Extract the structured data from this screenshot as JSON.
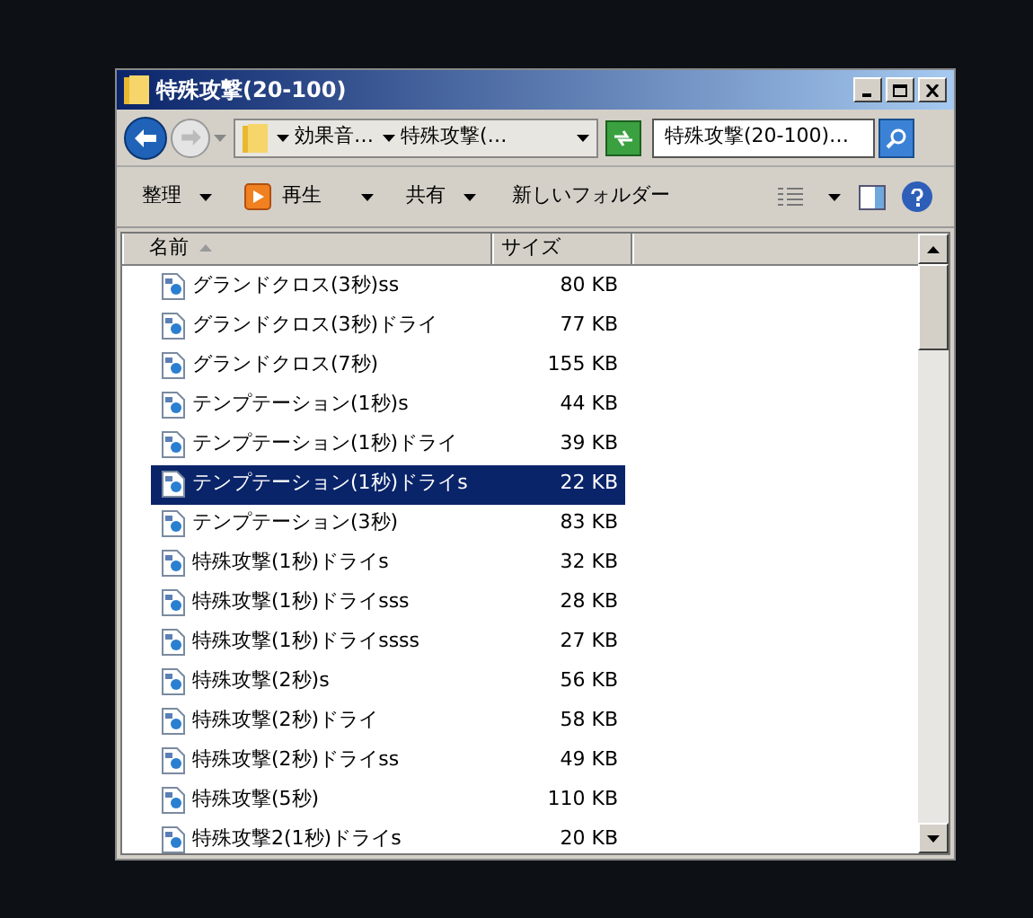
{
  "window": {
    "title": "特殊攻撃(20-100)"
  },
  "address": {
    "crumbs": [
      "効果音…",
      "特殊攻撃(…"
    ]
  },
  "search": {
    "value": "特殊攻撃(20-100)…"
  },
  "toolbar": [
    {
      "label": "整理",
      "kind": "menu"
    },
    {
      "label": "再生",
      "kind": "play"
    },
    {
      "label": "共有",
      "kind": "menu"
    },
    {
      "label": "新しいフォルダー",
      "kind": "plain"
    }
  ],
  "columns": [
    {
      "label": "名前",
      "sorted": true
    },
    {
      "label": "サイズ",
      "sorted": false
    }
  ],
  "rows": [
    {
      "name": "グランドクロス(3秒)ss",
      "size": "80 KB",
      "selected": false
    },
    {
      "name": "グランドクロス(3秒)ドライ",
      "size": "77 KB",
      "selected": false
    },
    {
      "name": "グランドクロス(7秒)",
      "size": "155 KB",
      "selected": false
    },
    {
      "name": "テンプテーション(1秒)s",
      "size": "44 KB",
      "selected": false
    },
    {
      "name": "テンプテーション(1秒)ドライ",
      "size": "39 KB",
      "selected": false
    },
    {
      "name": "テンプテーション(1秒)ドライs",
      "size": "22 KB",
      "selected": true
    },
    {
      "name": "テンプテーション(3秒)",
      "size": "83 KB",
      "selected": false
    },
    {
      "name": "特殊攻撃(1秒)ドライs",
      "size": "32 KB",
      "selected": false
    },
    {
      "name": "特殊攻撃(1秒)ドライsss",
      "size": "28 KB",
      "selected": false
    },
    {
      "name": "特殊攻撃(1秒)ドライssss",
      "size": "27 KB",
      "selected": false
    },
    {
      "name": "特殊攻撃(2秒)s",
      "size": "56 KB",
      "selected": false
    },
    {
      "name": "特殊攻撃(2秒)ドライ",
      "size": "58 KB",
      "selected": false
    },
    {
      "name": "特殊攻撃(2秒)ドライss",
      "size": "49 KB",
      "selected": false
    },
    {
      "name": "特殊攻撃(5秒)",
      "size": "110 KB",
      "selected": false
    },
    {
      "name": "特殊攻撃2(1秒)ドライs",
      "size": "20 KB",
      "selected": false
    }
  ]
}
